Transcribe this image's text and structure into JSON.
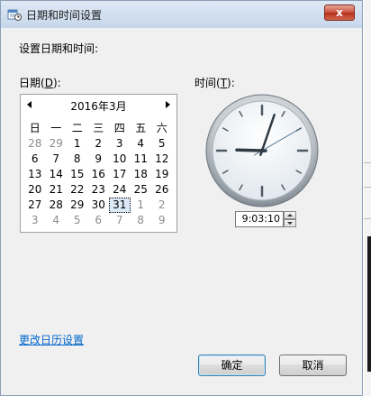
{
  "window": {
    "title": "日期和时间设置",
    "close_label": "x"
  },
  "heading": "设置日期和时间:",
  "date_label": {
    "text": "日期(",
    "key": "D",
    "suffix": "):"
  },
  "time_label": {
    "text": "时间(",
    "key": "T",
    "suffix": "):"
  },
  "calendar": {
    "month_title": "2016年3月",
    "weekdays": [
      "日",
      "一",
      "二",
      "三",
      "四",
      "五",
      "六"
    ],
    "weeks": [
      [
        {
          "d": "28",
          "dim": true
        },
        {
          "d": "29",
          "dim": true
        },
        {
          "d": "1"
        },
        {
          "d": "2"
        },
        {
          "d": "3"
        },
        {
          "d": "4"
        },
        {
          "d": "5"
        }
      ],
      [
        {
          "d": "6"
        },
        {
          "d": "7"
        },
        {
          "d": "8"
        },
        {
          "d": "9"
        },
        {
          "d": "10"
        },
        {
          "d": "11"
        },
        {
          "d": "12"
        }
      ],
      [
        {
          "d": "13"
        },
        {
          "d": "14"
        },
        {
          "d": "15"
        },
        {
          "d": "16"
        },
        {
          "d": "17"
        },
        {
          "d": "18"
        },
        {
          "d": "19"
        }
      ],
      [
        {
          "d": "20"
        },
        {
          "d": "21"
        },
        {
          "d": "22"
        },
        {
          "d": "23"
        },
        {
          "d": "24"
        },
        {
          "d": "25"
        },
        {
          "d": "26"
        }
      ],
      [
        {
          "d": "27"
        },
        {
          "d": "28"
        },
        {
          "d": "29"
        },
        {
          "d": "30"
        },
        {
          "d": "31",
          "selected": true
        },
        {
          "d": "1",
          "dim": true
        },
        {
          "d": "2",
          "dim": true
        }
      ],
      [
        {
          "d": "3",
          "dim": true
        },
        {
          "d": "4",
          "dim": true
        },
        {
          "d": "5",
          "dim": true
        },
        {
          "d": "6",
          "dim": true
        },
        {
          "d": "7",
          "dim": true
        },
        {
          "d": "8",
          "dim": true
        },
        {
          "d": "9",
          "dim": true
        }
      ]
    ]
  },
  "clock": {
    "hour": 9,
    "minute": 3,
    "second": 10
  },
  "time_value": "9:03:10",
  "change_calendar_link": "更改日历设置",
  "buttons": {
    "ok": "确定",
    "cancel": "取消"
  },
  "colors": {
    "link": "#0066cc",
    "close_button": "#c7503b",
    "selected_day": "#dbe8f6"
  }
}
